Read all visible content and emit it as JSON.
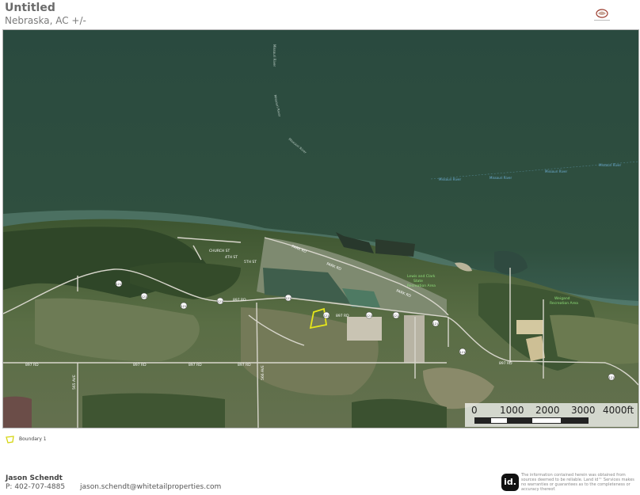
{
  "header": {
    "title": "Untitled",
    "subtitle": "Nebraska,  AC +/-"
  },
  "map": {
    "water_labels": [
      "Missouri River",
      "Missouri River",
      "Missouri River",
      "Missouri River",
      "Missouri River",
      "Missouri River",
      "Missouri River"
    ],
    "road_labels": [
      "897 RD",
      "897 RD",
      "897 RD",
      "897 RD",
      "897 RD",
      "897 RD",
      "897 RD",
      "PARK RD",
      "PARK RD",
      "PARK RD",
      "566 AVE",
      "565 AVE",
      "4TH ST",
      "5TH ST",
      "CHURCH ST"
    ],
    "route_shields": [
      "121",
      "121",
      "121",
      "121",
      "121",
      "121",
      "121",
      "121",
      "121",
      "121",
      "121"
    ],
    "poi_labels": [
      "Lewis and Clark",
      "State",
      "Recreation Area",
      "Weigand",
      "Recreation Area"
    ],
    "boundary_color": "#e6e61a",
    "water_color": "#2f4d43"
  },
  "scale": {
    "ticks": [
      "0",
      "1000",
      "2000",
      "3000",
      "4000ft"
    ]
  },
  "legend": {
    "items": [
      {
        "label": "Boundary 1",
        "icon": "boundary-polygon-icon",
        "color": "#e6e61a"
      }
    ]
  },
  "footer": {
    "agent_name": "Jason Schendt",
    "phone": "P: 402-707-4885",
    "email": "jason.schendt@whitetailproperties.com",
    "logo_text": "id.",
    "disclaimer": "The information contained herein was obtained from sources deemed to be reliable. Land id™ Services makes no warranties or guarantees as to the completeness or accuracy thereof."
  }
}
